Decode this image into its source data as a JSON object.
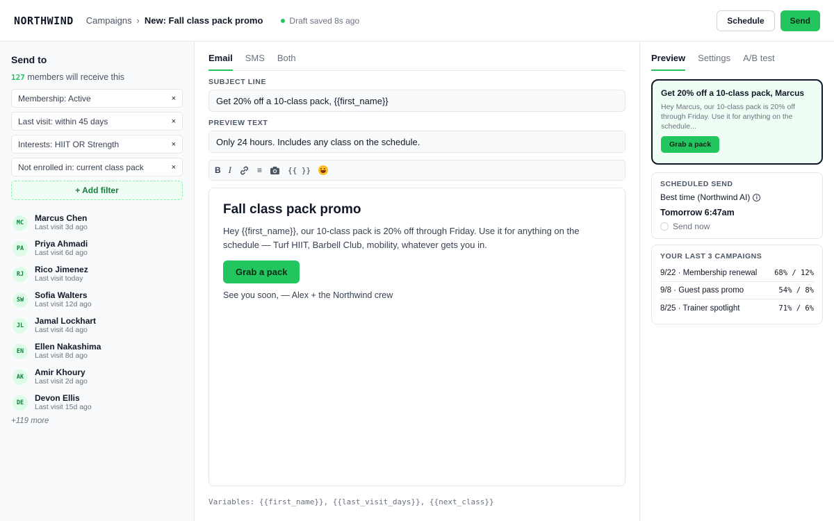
{
  "header": {
    "logo": "NORTHWIND",
    "breadcrumb_parent": "Campaigns",
    "breadcrumb_sep": "›",
    "breadcrumb_current": "New: Fall class pack promo",
    "status_text": "Draft saved 8s ago",
    "schedule_label": "Schedule",
    "send_label": "Send"
  },
  "audience": {
    "title": "Send to",
    "count": "127",
    "count_suffix": " members will receive this",
    "filters": [
      {
        "label": "Membership: Active",
        "remove": "×"
      },
      {
        "label": "Last visit: within 45 days",
        "remove": "×"
      },
      {
        "label": "Interests: HIIT OR Strength",
        "remove": "×"
      },
      {
        "label": "Not enrolled in: current class pack",
        "remove": "×"
      }
    ],
    "add_filter_label": "+ Add filter",
    "members": [
      {
        "initials": "MC",
        "name": "Marcus Chen",
        "sub": "Last visit 3d ago"
      },
      {
        "initials": "PA",
        "name": "Priya Ahmadi",
        "sub": "Last visit 6d ago"
      },
      {
        "initials": "RJ",
        "name": "Rico Jimenez",
        "sub": "Last visit today"
      },
      {
        "initials": "SW",
        "name": "Sofia Walters",
        "sub": "Last visit 12d ago"
      },
      {
        "initials": "JL",
        "name": "Jamal Lockhart",
        "sub": "Last visit 4d ago"
      },
      {
        "initials": "EN",
        "name": "Ellen Nakashima",
        "sub": "Last visit 8d ago"
      },
      {
        "initials": "AK",
        "name": "Amir Khoury",
        "sub": "Last visit 2d ago"
      },
      {
        "initials": "DE",
        "name": "Devon Ellis",
        "sub": "Last visit 15d ago"
      }
    ],
    "more_label": "+119 more"
  },
  "composer": {
    "tabs": [
      "Email",
      "SMS",
      "Both"
    ],
    "subject_label": "SUBJECT LINE",
    "subject_value": "Get 20% off a 10-class pack, {{first_name}}",
    "preview_label": "PREVIEW TEXT",
    "preview_value": "Only 24 hours. Includes any class on the schedule.",
    "toolbar": {
      "bold": "B",
      "italic": "I",
      "list": "≡",
      "variable": "{{ }}"
    },
    "email": {
      "heading": "Fall class pack promo",
      "body": "Hey {{first_name}}, our 10-class pack is 20% off through Friday. Use it for anything on the schedule — Turf HIIT, Barbell Club, mobility, whatever gets you in.",
      "cta": "Grab a pack",
      "signoff": "See you soon, — Alex + the Northwind crew"
    },
    "variables_line": "Variables: {{first_name}}, {{last_visit_days}}, {{next_class}}"
  },
  "sidebar_right": {
    "tabs": [
      "Preview",
      "Settings",
      "A/B test"
    ],
    "preview": {
      "title": "Get 20% off a 10-class pack, Marcus",
      "body": "Hey Marcus, our 10-class pack is 20% off through Friday. Use it for anything on the schedule...",
      "cta": "Grab a pack"
    },
    "scheduled": {
      "title": "SCHEDULED SEND",
      "best_time": "Best time (Northwind AI)",
      "info": "i",
      "time": "Tomorrow 6:47am",
      "send_now": "Send now"
    },
    "campaigns": {
      "title": "YOUR LAST 3 CAMPAIGNS",
      "rows": [
        {
          "name": "9/22 · Membership renewal",
          "stats": "68% / 12%"
        },
        {
          "name": "9/8 · Guest pass promo",
          "stats": "54% / 8%"
        },
        {
          "name": "8/25 · Trainer spotlight",
          "stats": "71% / 6%"
        }
      ]
    }
  },
  "colors": {
    "accent": "#22c55e",
    "accent_dark": "#15803d",
    "text": "#111827",
    "muted": "#6b7280",
    "border": "#e5e7eb"
  }
}
